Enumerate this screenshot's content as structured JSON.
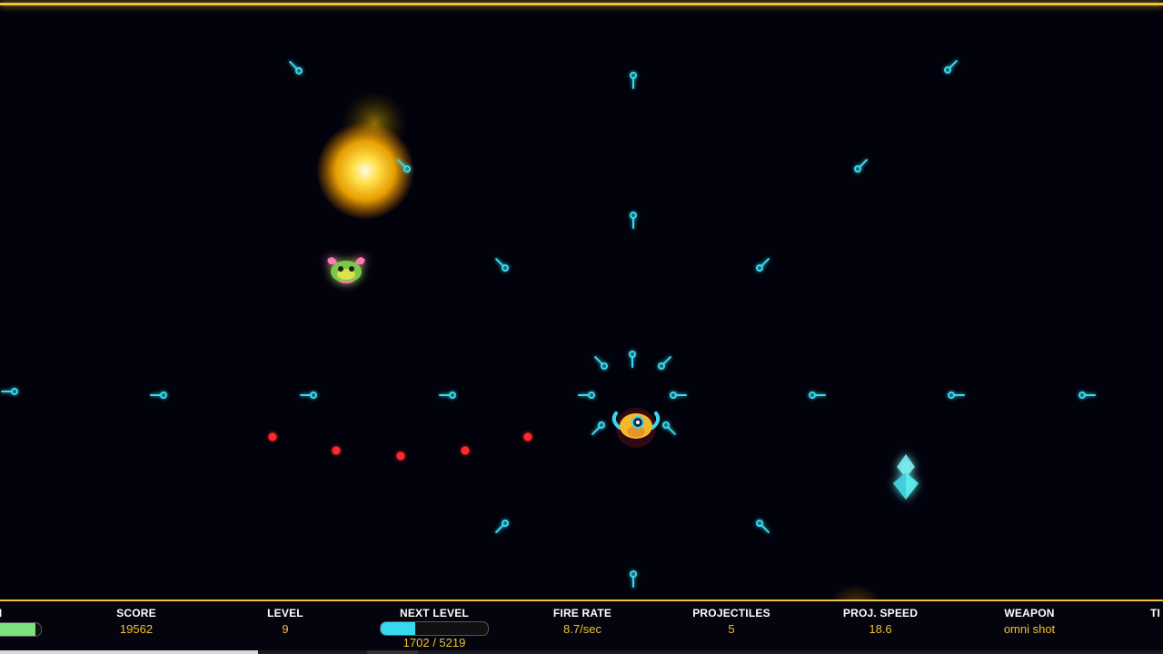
{
  "hud": {
    "health": {
      "label": "TH",
      "value": "80",
      "fill_fraction": 0.9
    },
    "score": {
      "label": "SCORE",
      "value": "19562"
    },
    "level": {
      "label": "LEVEL",
      "value": "9"
    },
    "next_level": {
      "label": "NEXT LEVEL",
      "value": "1702 / 5219",
      "current": 1702,
      "required": 5219
    },
    "fire_rate": {
      "label": "FIRE RATE",
      "value": "8.7/sec"
    },
    "projectiles": {
      "label": "PROJECTILES",
      "value": "5"
    },
    "proj_speed": {
      "label": "PROJ. SPEED",
      "value": "18.6"
    },
    "weapon": {
      "label": "WEAPON",
      "value": "omni shot"
    },
    "time": {
      "label": "TI"
    }
  },
  "colors": {
    "accent": "#f2c230",
    "projectile": "#38d9ee",
    "enemy_bullet": "#ff2a2a",
    "health_fill": "#7de07d",
    "xp_fill": "#38d9ee",
    "player_body": "#f5b82a",
    "enemy_body": "#7ec84a",
    "enemy_ears": "#ff7ab3",
    "crystal": "#5ff0f0",
    "explosion": "#ffb400"
  },
  "icons": {
    "player": "player-ship-icon",
    "enemy": "green-crab-enemy-icon",
    "crystal": "xp-crystal-icon",
    "explosion": "explosion-icon"
  }
}
